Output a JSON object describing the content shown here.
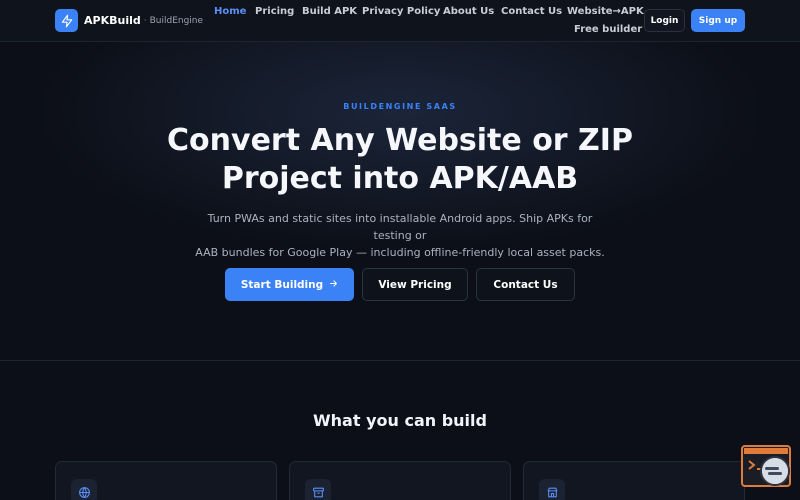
{
  "brand": {
    "name": "APKBuild",
    "separator": "·",
    "subtitle": "BuildEngine"
  },
  "nav": {
    "items": [
      {
        "label": "Home",
        "active": true
      },
      {
        "label": "Pricing"
      },
      {
        "label": "Build APK"
      },
      {
        "label": "Privacy Policy"
      },
      {
        "label": "About Us"
      },
      {
        "label": "Contact Us"
      },
      {
        "label": "Website→APK"
      },
      {
        "label": "Free builder"
      }
    ],
    "login": "Login",
    "signup": "Sign up"
  },
  "hero": {
    "eyebrow": "BUILDENGINE SAAS",
    "title_line1": "Convert Any Website or ZIP",
    "title_line2": "Project into APK/AAB",
    "desc_line1": "Turn PWAs and static sites into installable Android apps. Ship APKs for testing or",
    "desc_line2": "AAB bundles for Google Play — including offline-friendly local asset packs.",
    "cta_primary": "Start Building",
    "cta_pricing": "View Pricing",
    "cta_contact": "Contact Us"
  },
  "features": {
    "title": "What you can build",
    "cards": [
      {
        "icon": "globe-icon"
      },
      {
        "icon": "archive-box-icon"
      },
      {
        "icon": "store-icon"
      }
    ]
  },
  "colors": {
    "accent": "#3b82f6",
    "background": "#0c0f17",
    "widget_border": "#e07b39"
  }
}
